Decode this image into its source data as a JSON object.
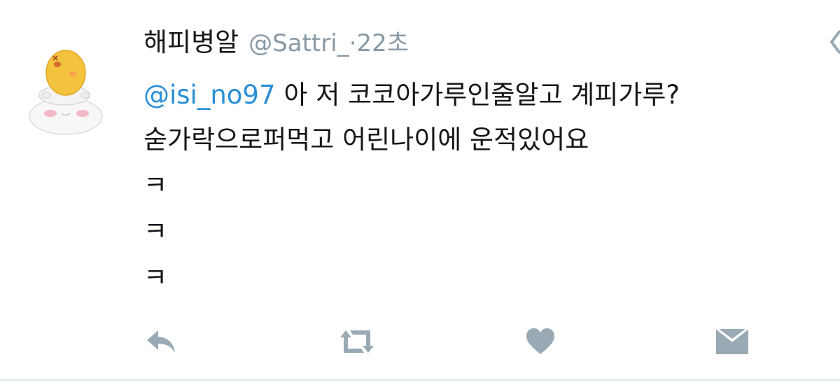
{
  "tweet": {
    "display_name": "해피병알",
    "handle": "@Sattri_",
    "separator": "·",
    "time": "22초",
    "mention": "@isi_no97",
    "text_line1": "아 저 코코아가루인줄알고 계피가루?",
    "text_line2": "숟가락으로퍼먹고 어린나이에 운적있어요",
    "laugh_lines": [
      "ㅋ",
      "ㅋ",
      "ㅋ"
    ]
  },
  "actions": {
    "reply_icon": "reply-icon",
    "retweet_icon": "retweet-icon",
    "like_icon": "heart-icon",
    "dm_icon": "envelope-icon"
  },
  "colors": {
    "mention": "#2a8fd6",
    "meta": "#8899a6",
    "icon": "#99aab5",
    "text": "#14171a"
  }
}
